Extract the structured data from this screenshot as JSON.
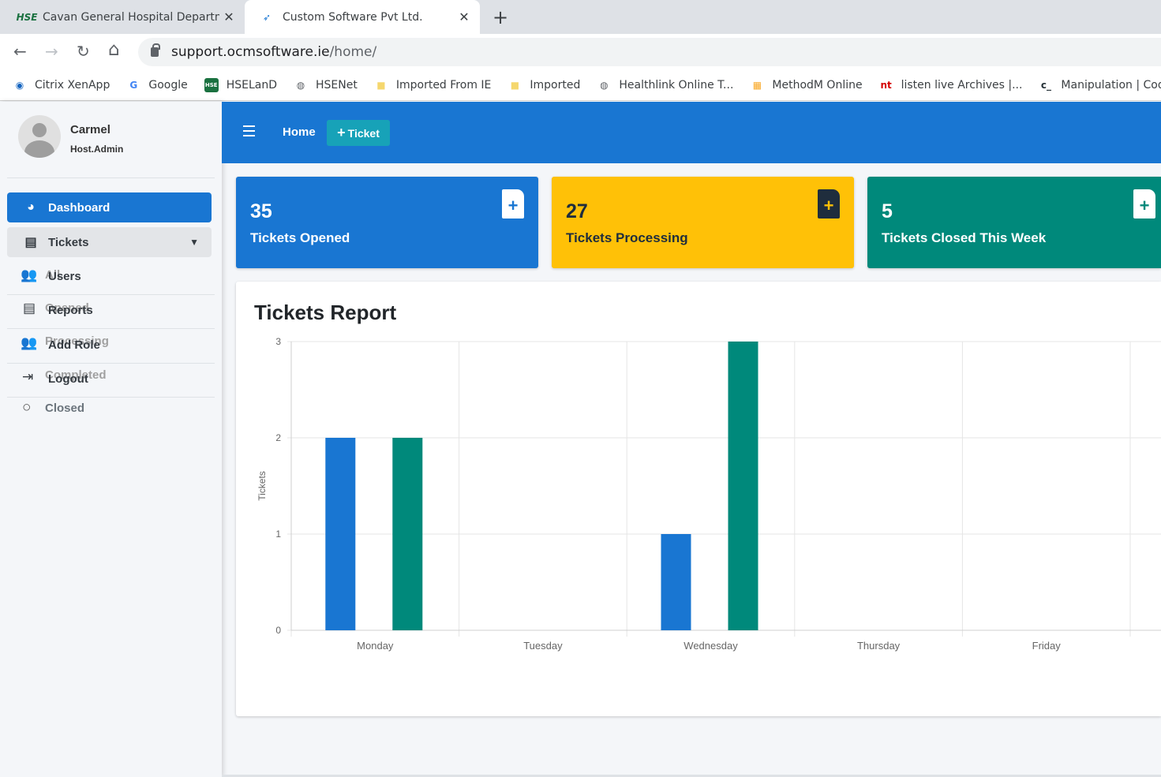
{
  "browser": {
    "tabs": [
      {
        "favicon": "HSE-logo",
        "title": "Cavan General Hospital Departm",
        "close": "✕"
      },
      {
        "favicon": "ocm-logo",
        "title": "Custom Software Pvt Ltd.",
        "close": "✕"
      }
    ],
    "new_tab": "+",
    "nav": {
      "back": "←",
      "forward": "→",
      "reload": "↻",
      "home": "⌂"
    },
    "url_host": "support.ocmsoftware.ie",
    "url_path": "/home/",
    "bookmarks": [
      {
        "icon": "citrix-icon",
        "glyph": "◉",
        "color": "#1565c0",
        "label": "Citrix XenApp"
      },
      {
        "icon": "google-icon",
        "glyph": "G",
        "color": "#4285f4",
        "label": "Google"
      },
      {
        "icon": "hse-icon",
        "glyph": "HSE",
        "color": "#1a7140",
        "label": "HSELanD"
      },
      {
        "icon": "globe-icon",
        "glyph": "◍",
        "color": "#5f6368",
        "label": "HSENet"
      },
      {
        "icon": "folder-icon",
        "glyph": "■",
        "color": "#f5d76e",
        "label": "Imported From IE"
      },
      {
        "icon": "folder-icon",
        "glyph": "■",
        "color": "#f5d76e",
        "label": "Imported"
      },
      {
        "icon": "globe-icon",
        "glyph": "◍",
        "color": "#5f6368",
        "label": "Healthlink Online T..."
      },
      {
        "icon": "methodm-icon",
        "glyph": "▦",
        "color": "#f9a825",
        "label": "MethodM Online"
      },
      {
        "icon": "nt-icon",
        "glyph": "nt",
        "color": "#d50000",
        "label": "listen live Archives |..."
      },
      {
        "icon": "code-icon",
        "glyph": "c_",
        "color": "#263238",
        "label": "Manipulation | Cod..."
      }
    ]
  },
  "sidebar": {
    "user": {
      "name": "Carmel",
      "role": "Host.Admin"
    },
    "dashboard": {
      "label": "Dashboard",
      "icon": "gauge-icon"
    },
    "tickets": {
      "label": "Tickets",
      "icon": "inbox-icon",
      "chevron": "▼"
    },
    "submenu": [
      "All",
      "Opened",
      "Processing",
      "Completed",
      "Closed"
    ],
    "items": [
      {
        "label": "Users",
        "icon": "users-icon"
      },
      {
        "label": "Reports",
        "icon": "report-icon"
      },
      {
        "label": "Add Role",
        "icon": "users-icon"
      },
      {
        "label": "Logout",
        "icon": "logout-icon"
      }
    ]
  },
  "header": {
    "home": "Home",
    "ticket_button": "Ticket",
    "ticket_plus": "+"
  },
  "cards": [
    {
      "value": "35",
      "label": "Tickets Opened",
      "color": "#1976d2"
    },
    {
      "value": "27",
      "label": "Tickets Processing",
      "color": "#ffc107"
    },
    {
      "value": "5",
      "label": "Tickets Closed This Week",
      "color": "#00897b"
    }
  ],
  "report": {
    "title": "Tickets Report"
  },
  "chart_data": {
    "type": "bar",
    "title": "Tickets Report",
    "categories": [
      "Monday",
      "Tuesday",
      "Wednesday",
      "Thursday",
      "Friday"
    ],
    "series": [
      {
        "values": [
          2,
          0,
          1,
          0,
          0
        ],
        "color": "#1976d2"
      },
      {
        "values": [
          2,
          0,
          3,
          0,
          0
        ],
        "color": "#00897b"
      }
    ],
    "ylabel": "Tickets",
    "yticks": [
      "0",
      "1",
      "2",
      "3"
    ],
    "ylim": [
      0,
      3
    ],
    "grid": true,
    "legend": "none"
  }
}
